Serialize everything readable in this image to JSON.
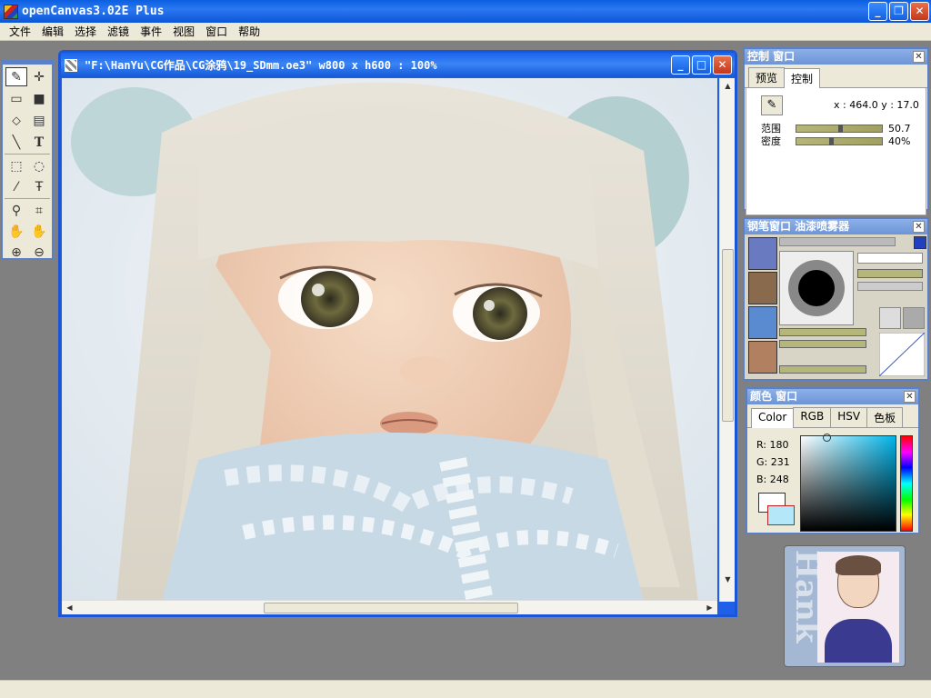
{
  "app": {
    "title": "openCanvas3.02E Plus"
  },
  "menu": [
    "文件",
    "编辑",
    "选择",
    "滤镜",
    "事件",
    "视图",
    "窗口",
    "帮助"
  ],
  "document": {
    "title": "\"F:\\HanYu\\CG作品\\CG涂鸦\\19_SDmm.oe3\" w800 x h600 : 100%"
  },
  "control_panel": {
    "title": "控制 窗口",
    "tabs": [
      "预览",
      "控制"
    ],
    "active_tab": "控制",
    "coords": "x : 464.0  y : 17.0",
    "range_label": "范围",
    "range_value": "50.7",
    "density_label": "密度",
    "density_value": "40%",
    "range_level": 50.7,
    "density_level": 40
  },
  "pen_panel": {
    "title": "钢笔窗口  油漆喷雾器"
  },
  "color_panel": {
    "title": "颜色 窗口",
    "tabs": [
      "Color",
      "RGB",
      "HSV",
      "色板"
    ],
    "active_tab": "Color",
    "r": "R: 180",
    "g": "G: 231",
    "b": "B: 248",
    "foreground": "#ffffff",
    "background_color": "#b4e7f8"
  },
  "avatar": {
    "text": "Hank"
  }
}
